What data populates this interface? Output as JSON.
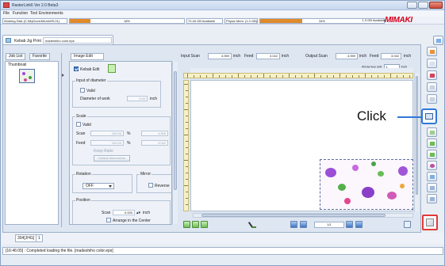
{
  "window": {
    "title": "RasterLink6 Ver 2.0 Beta3"
  },
  "menu": [
    "File",
    "Function",
    "Tool",
    "Environments"
  ],
  "status": {
    "working_disk": "Working Disk (C:\\MyDocs\\MiLink\\RL01)",
    "disk_percent_label": "18%",
    "disk_percent": 0.18,
    "disk_available": "70.45 GB Available",
    "phys_mem": "Physic Mem. (1.0 GB)",
    "mem_percent_label": "34%",
    "mem_percent": 0.34,
    "mem_available": "1.3 GB Available"
  },
  "brand": {
    "logo": "MIMAKI",
    "color": "#d6001c"
  },
  "job_tab": {
    "label": "Kebab Jig Print",
    "filename": "madeshiho color.eps"
  },
  "left_tabs": {
    "job_list": "Job List",
    "favorite": "Favorite",
    "image_edit": "Image Edit"
  },
  "thumbnail": {
    "label": "Thumbnail"
  },
  "image_edit": {
    "kebab_edit": "Kebab Edit",
    "kebab_edit_checked": true,
    "input_diameter": {
      "group": "Input of diameter",
      "valid": "Valid",
      "diameter_label": "Diameter of work",
      "diameter_value": "0.00",
      "unit": "inch"
    },
    "scale": {
      "group": "Scale",
      "valid": "Valid",
      "scan_label": "Scan",
      "scan_percent": "100.00",
      "scan_value": "4.959",
      "feed_label": "Feed",
      "feed_percent": "100.00",
      "feed_value": "3.042",
      "percent": "%",
      "keep_ratio": "Keep Ratio",
      "default_btn": "Default dimensions"
    },
    "rotation": {
      "group": "Rotation",
      "value": "OFF"
    },
    "mirror": {
      "group": "Mirror",
      "reverse": "Reverse"
    },
    "position": {
      "group": "Position",
      "scan_label": "Scan",
      "scan_value": "0.000",
      "unit": "inch",
      "arrange_center": "Arrange in the Center"
    }
  },
  "input_fields": {
    "input_scan_label": "Input Scan",
    "input_scan_value": "4.959",
    "input_scan_unit": "inch",
    "feed_label": "Feed",
    "feed_value": "3.042",
    "feed_unit": "inch",
    "output_scan_label": "Output Scan",
    "output_scan_value": "4.959",
    "output_scan_unit": "inch",
    "output_feed_label": "Feed",
    "output_feed_value": "3.042",
    "output_feed_unit": "inch",
    "arrow_key_label": "Arrow key unit",
    "arrow_key_value": "1",
    "arrow_key_unit": "inch"
  },
  "pager": {
    "value": "1/1"
  },
  "annotation": {
    "click_label": "Click"
  },
  "bottom_tabs": [
    "304[JHG]",
    "1"
  ],
  "log": {
    "message": "[16:46:05] : Completed loading the file. [madeshiho color.eps]"
  }
}
